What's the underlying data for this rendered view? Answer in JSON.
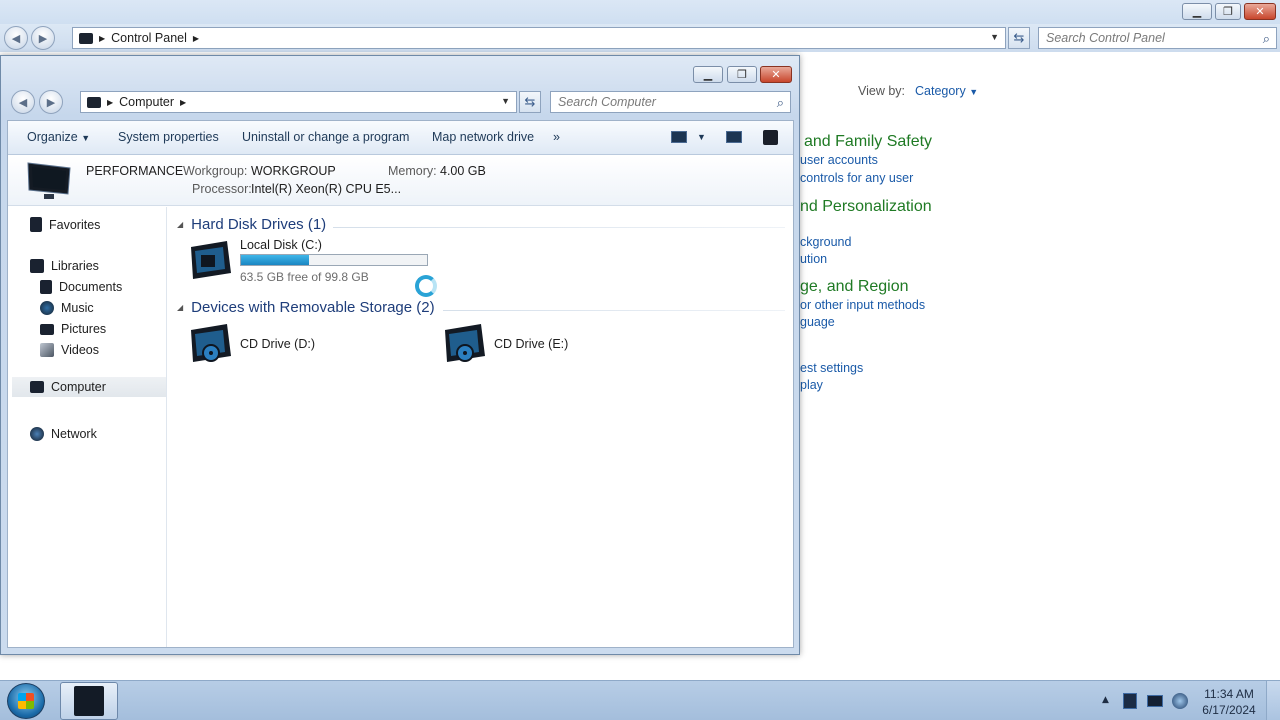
{
  "control_panel": {
    "address_segment": "Control Panel",
    "search_placeholder": "Search Control Panel",
    "view_by_label": "View by:",
    "view_by_value": "Category",
    "headings": [
      "and Family Safety",
      "nd Personalization",
      "ge, and Region"
    ],
    "links": [
      "user accounts",
      "controls for any user",
      "ckground",
      "ution",
      "or other input methods",
      "guage",
      "est settings",
      "play"
    ],
    "window_buttons": {
      "minimize": "minimize-icon",
      "restore": "restore-icon",
      "close": "close-icon"
    }
  },
  "computer_window": {
    "address_segment": "Computer",
    "search_placeholder": "Search Computer",
    "toolbar": {
      "organize": "Organize",
      "system_properties": "System properties",
      "uninstall": "Uninstall or change a program",
      "map_drive": "Map network drive",
      "more": "»"
    },
    "details": {
      "computer_name": "PERFORMANCE",
      "workgroup_label": "Workgroup:",
      "workgroup_value": "WORKGROUP",
      "memory_label": "Memory:",
      "memory_value": "4.00 GB",
      "processor_label": "Processor:",
      "processor_value": "Intel(R) Xeon(R) CPU E5..."
    },
    "nav_pane": {
      "favorites": "Favorites",
      "libraries": "Libraries",
      "documents": "Documents",
      "music": "Music",
      "pictures": "Pictures",
      "videos": "Videos",
      "computer": "Computer",
      "network": "Network"
    },
    "groups": {
      "hard_disks": "Hard Disk Drives (1)",
      "removable": "Devices with Removable Storage (2)"
    },
    "drives": {
      "local_disk": {
        "label": "Local Disk (C:)",
        "free_text": "63.5 GB free of 99.8 GB",
        "used_fraction": 0.364
      },
      "cd_d": {
        "label": "CD Drive (D:)"
      },
      "cd_e": {
        "label": "CD Drive (E:)"
      }
    }
  },
  "taskbar": {
    "time": "11:34 AM",
    "date": "6/17/2024",
    "tray_expand": "▲"
  },
  "colors": {
    "link_blue": "#1a5aa8",
    "heading_green": "#1f7a24",
    "group_heading": "#1e3d7a",
    "capacity_fill": "#2a9fd8"
  }
}
